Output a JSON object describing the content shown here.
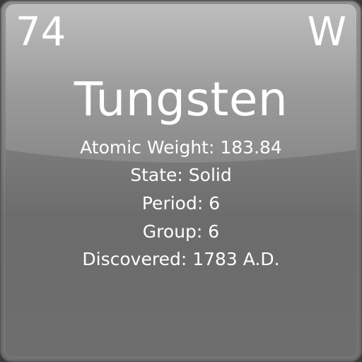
{
  "element": {
    "number": "74",
    "symbol": "W",
    "name": "Tungsten",
    "atomic_weight": "Atomic Weight: 183.84",
    "state": "State: Solid",
    "period": "Period: 6",
    "group": "Group: 6",
    "discovered": "Discovered: 1783 A.D."
  },
  "colors": {
    "tile": "#7a7a7a",
    "text": "#ffffff"
  }
}
